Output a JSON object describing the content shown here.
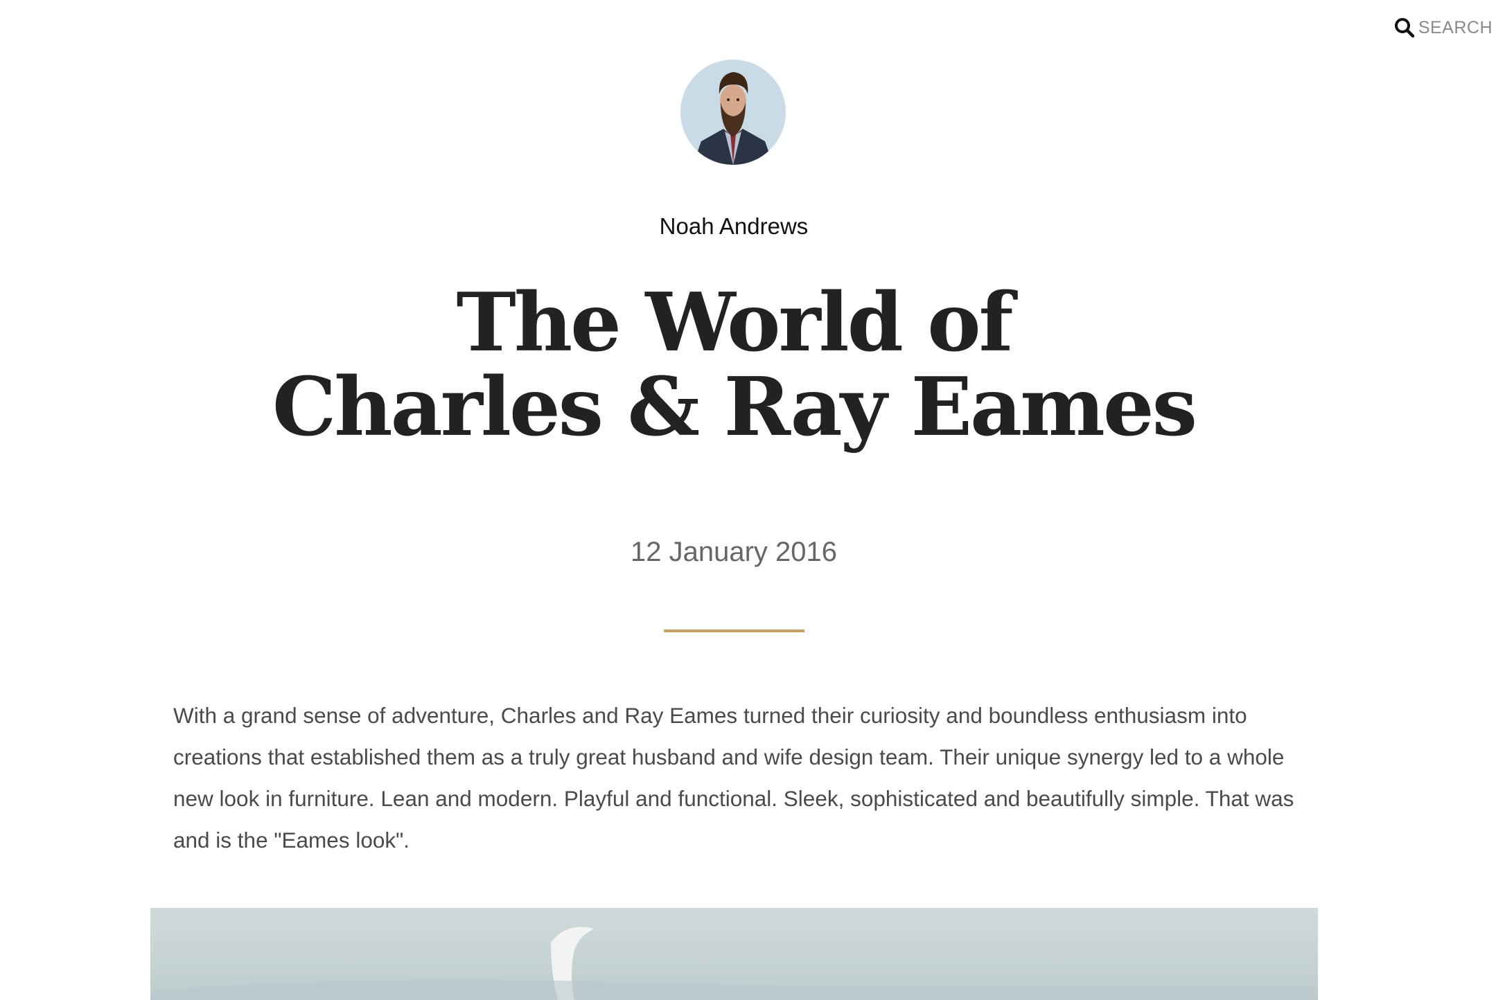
{
  "search": {
    "label": "SEARCH",
    "icon": "search-icon"
  },
  "author": {
    "name": "Noah Andrews",
    "avatar_icon": "avatar"
  },
  "article": {
    "title_line1": "The World of",
    "title_line2": "Charles & Ray Eames",
    "date": "12 January 2016",
    "intro": "With a grand sense of adventure, Charles and Ray Eames turned their curiosity and boundless enthusiasm into creations that established them as a truly great husband and wife design team. Their unique synergy led to a whole new look in furniture. Lean and modern. Playful and functional. Sleek, sophisticated and beautifully simple. That was and is the \"Eames look\"."
  },
  "colors": {
    "accent": "#c9a063",
    "title": "#222222",
    "body_text": "#4a4a4a",
    "muted": "#8a8a8a"
  }
}
